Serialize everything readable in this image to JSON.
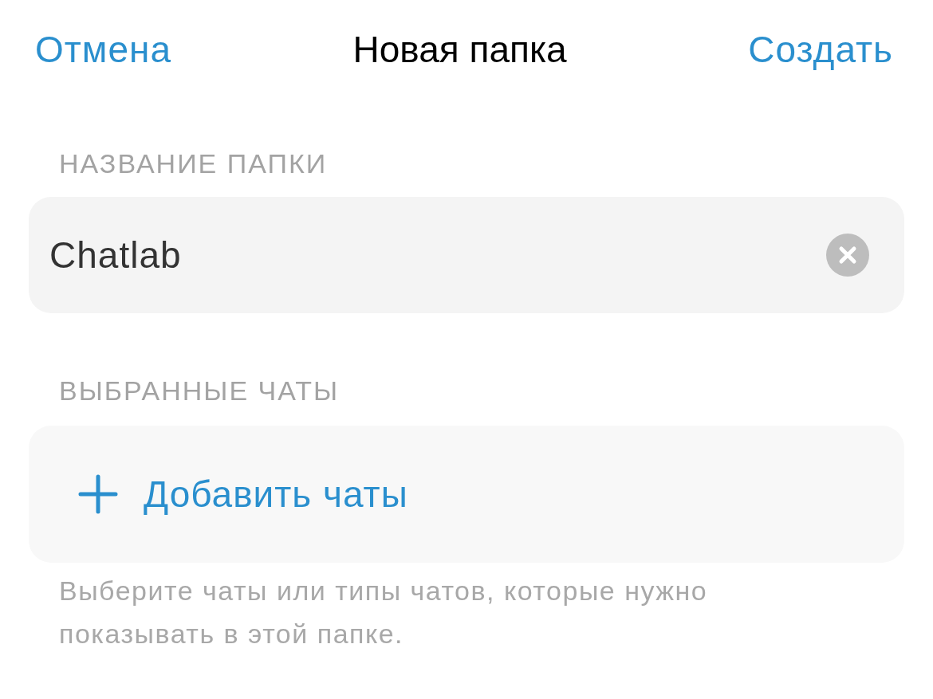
{
  "nav": {
    "cancel": "Отмена",
    "title": "Новая папка",
    "create": "Создать"
  },
  "name_section": {
    "label": "НАЗВАНИЕ ПАПКИ",
    "field": {
      "value": "Chatlab"
    }
  },
  "chats_section": {
    "label": "ВЫБРАННЫЕ ЧАТЫ",
    "add_button": "Добавить чаты",
    "hint": "Выберите чаты или типы чатов, которые нужно показывать в этой папке."
  }
}
